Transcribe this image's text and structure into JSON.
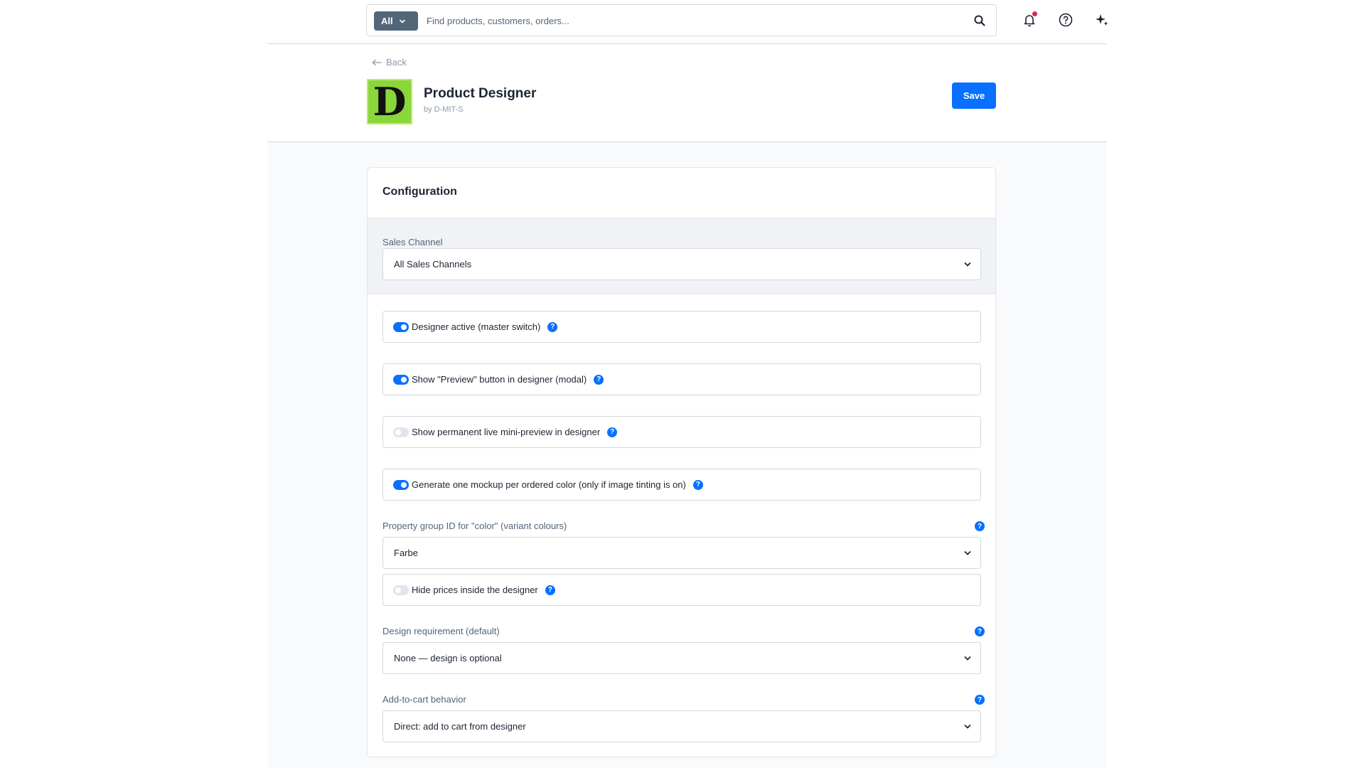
{
  "topbar": {
    "scope_label": "All",
    "search_placeholder": "Find products, customers, orders..."
  },
  "header": {
    "back_label": "Back",
    "logo_letter": "D",
    "app_title": "Product Designer",
    "app_vendor": "by D-MIT-S",
    "save_label": "Save"
  },
  "config": {
    "title": "Configuration",
    "sales_channel_label": "Sales Channel",
    "sales_channel_value": "All Sales Channels",
    "switches": [
      {
        "label": "Designer active (master switch)",
        "on": true
      },
      {
        "label": "Show \"Preview\" button in designer (modal)",
        "on": true
      },
      {
        "label": "Show permanent live mini-preview in designer",
        "on": false
      },
      {
        "label": "Generate one mockup per ordered color (only if image tinting is on)",
        "on": true
      }
    ],
    "color_group_label": "Property group ID for \"color\" (variant colours)",
    "color_group_value": "Farbe",
    "hide_prices_label": "Hide prices inside the designer",
    "hide_prices_on": false,
    "design_req_label": "Design requirement (default)",
    "design_req_value": "None — design is optional",
    "cart_label": "Add-to-cart behavior",
    "cart_value": "Direct: add to cart from designer",
    "help_glyph": "?"
  },
  "colors": {
    "accent": "#0870ff",
    "scope_button": "#52667a",
    "logo_bg": "#8bd63a",
    "notification_dot": "#de294c"
  }
}
